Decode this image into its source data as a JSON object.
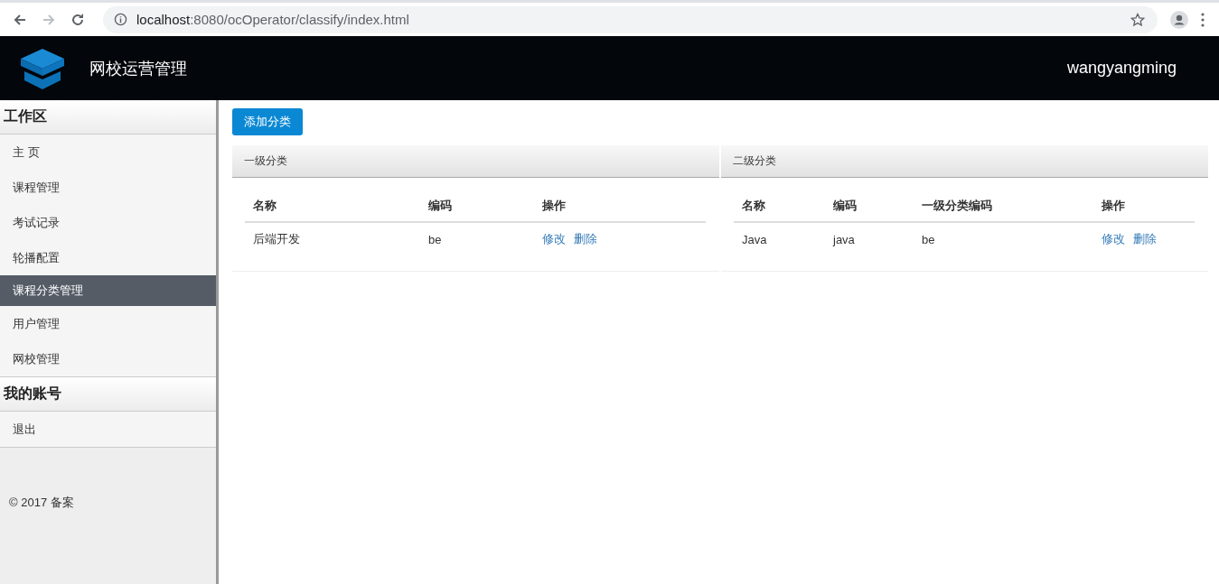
{
  "browser": {
    "url_host": "localhost",
    "url_rest": ":8080/ocOperator/classify/index.html"
  },
  "header": {
    "title": "网校运营管理",
    "user": "wangyangming"
  },
  "sidebar": {
    "sections": [
      {
        "title": "工作区",
        "items": [
          {
            "label": "主 页",
            "selected": false
          },
          {
            "label": "课程管理",
            "selected": false
          },
          {
            "label": "考试记录",
            "selected": false
          },
          {
            "label": "轮播配置",
            "selected": false
          },
          {
            "label": "课程分类管理",
            "selected": true
          },
          {
            "label": "用户管理",
            "selected": false
          },
          {
            "label": "网校管理",
            "selected": false
          }
        ]
      },
      {
        "title": "我的账号",
        "items": [
          {
            "label": "退出",
            "selected": false
          }
        ]
      }
    ],
    "footer": "© 2017  备案"
  },
  "add_button": "添加分类",
  "panels": [
    {
      "title": "一级分类",
      "columns": [
        "名称",
        "编码",
        "操作"
      ],
      "rows": [
        {
          "cells": [
            "后端开发",
            "be"
          ],
          "actions": [
            "修改",
            "删除"
          ]
        }
      ]
    },
    {
      "title": "二级分类",
      "columns": [
        "名称",
        "编码",
        "一级分类编码",
        "操作"
      ],
      "rows": [
        {
          "cells": [
            "Java",
            "java",
            "be"
          ],
          "actions": [
            "修改",
            "删除"
          ]
        }
      ]
    }
  ]
}
